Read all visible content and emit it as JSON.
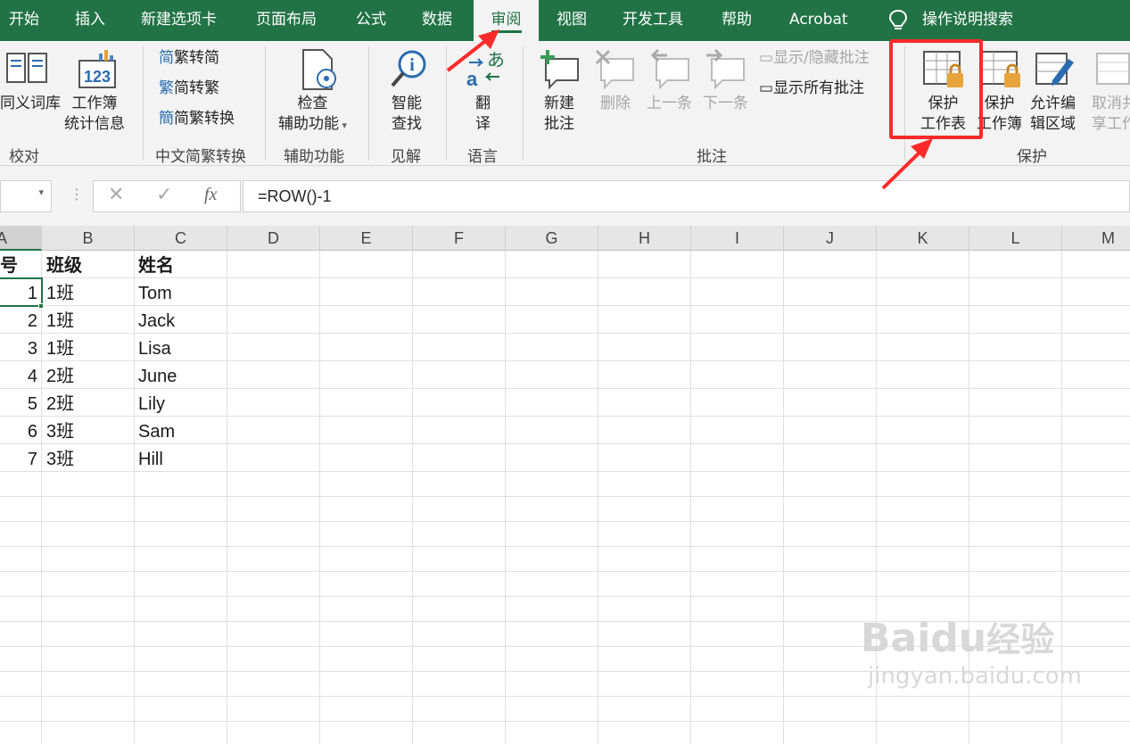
{
  "tabs": [
    {
      "label": "开始"
    },
    {
      "label": "插入"
    },
    {
      "label": "新建选项卡"
    },
    {
      "label": "页面布局"
    },
    {
      "label": "公式"
    },
    {
      "label": "数据"
    },
    {
      "label": "审阅",
      "active": true
    },
    {
      "label": "视图"
    },
    {
      "label": "开发工具"
    },
    {
      "label": "帮助"
    },
    {
      "label": "Acrobat"
    }
  ],
  "tell_me": "操作说明搜索",
  "ribbon": {
    "proofing": {
      "thesaurus": "同义词库",
      "stats_1": "工作簿",
      "stats_2": "统计信息",
      "group": "校对"
    },
    "chinese": {
      "to_trad": "繁转简",
      "to_simp": "简转繁",
      "convert": "简繁转换",
      "group": "中文简繁转换"
    },
    "accessibility": {
      "check_1": "检查",
      "check_2": "辅助功能",
      "group": "辅助功能"
    },
    "insights": {
      "smart_1": "智能",
      "smart_2": "查找",
      "group": "见解"
    },
    "language": {
      "translate_1": "翻",
      "translate_2": "译",
      "group": "语言"
    },
    "comments": {
      "new_1": "新建",
      "new_2": "批注",
      "delete": "删除",
      "prev": "上一条",
      "next": "下一条",
      "show_hide": "显示/隐藏批注",
      "show_all": "显示所有批注",
      "group": "批注"
    },
    "protect": {
      "sheet_1": "保护",
      "sheet_2": "工作表",
      "workbook_1": "保护",
      "workbook_2": "工作簿",
      "ranges_1": "允许编",
      "ranges_2": "辑区域",
      "unshare_1": "取消共",
      "unshare_2": "享工作簿",
      "group": "保护"
    }
  },
  "formula": {
    "value": "=ROW()-1",
    "fx": "fx"
  },
  "columns": [
    "A",
    "B",
    "C",
    "D",
    "E",
    "F",
    "G",
    "H",
    "I",
    "J",
    "K",
    "L",
    "M"
  ],
  "sheet": {
    "header": {
      "a": "号",
      "b": "班级",
      "c": "姓名"
    },
    "rows": [
      {
        "a": "1",
        "b": "1班",
        "c": "Tom"
      },
      {
        "a": "2",
        "b": "1班",
        "c": "Jack"
      },
      {
        "a": "3",
        "b": "1班",
        "c": "Lisa"
      },
      {
        "a": "4",
        "b": "2班",
        "c": "June"
      },
      {
        "a": "5",
        "b": "2班",
        "c": "Lily"
      },
      {
        "a": "6",
        "b": "3班",
        "c": "Sam"
      },
      {
        "a": "7",
        "b": "3班",
        "c": "Hill"
      }
    ]
  },
  "watermark": {
    "brand": "Baidu",
    "brand_cn": "经验",
    "url": "jingyan.baidu.com"
  },
  "colors": {
    "excel_green": "#217346",
    "highlight_red": "#ff2a2a"
  }
}
